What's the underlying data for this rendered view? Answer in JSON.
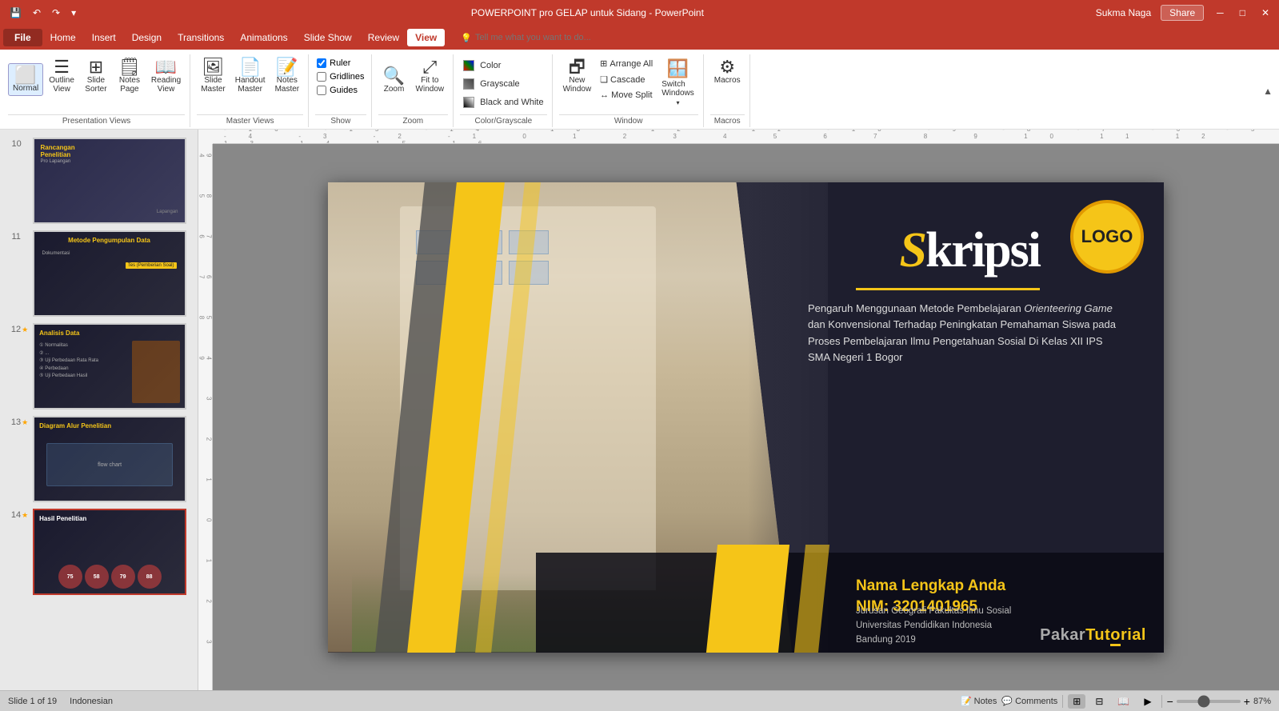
{
  "titlebar": {
    "title": "POWERPOINT pro GELAP untuk Sidang - PowerPoint",
    "quickaccess": [
      "save",
      "undo",
      "redo",
      "more"
    ]
  },
  "menubar": {
    "items": [
      "File",
      "Home",
      "Insert",
      "Design",
      "Transitions",
      "Animations",
      "Slide Show",
      "Review",
      "View"
    ],
    "active": "View",
    "tell_me_placeholder": "Tell me what you want to do...",
    "user": "Sukma Naga",
    "share": "Share"
  },
  "ribbon": {
    "presentation_views": {
      "label": "Presentation Views",
      "buttons": [
        "Normal",
        "Outline View",
        "Slide Sorter",
        "Notes Page",
        "Reading View"
      ]
    },
    "master_views": {
      "label": "Master Views",
      "buttons": [
        "Slide Master",
        "Handout Master",
        "Notes Master"
      ]
    },
    "show": {
      "label": "Show",
      "checkboxes": [
        "Ruler",
        "Gridlines",
        "Guides"
      ]
    },
    "zoom": {
      "label": "Zoom",
      "buttons": [
        "Zoom",
        "Fit to Window"
      ]
    },
    "color_grayscale": {
      "label": "Color/Grayscale",
      "items": [
        "Color",
        "Grayscale",
        "Black and White"
      ]
    },
    "window": {
      "label": "Window",
      "buttons": [
        "New Window",
        "Arrange All",
        "Cascade",
        "Move Split",
        "Switch Windows"
      ]
    },
    "macros": {
      "label": "Macros",
      "buttons": [
        "Macros"
      ]
    }
  },
  "slides": [
    {
      "number": "10",
      "star": false,
      "label": "Rancangan Penelitian"
    },
    {
      "number": "11",
      "star": false,
      "label": "Metode Pengumpulan Data"
    },
    {
      "number": "12",
      "star": true,
      "label": "Analisis Data"
    },
    {
      "number": "13",
      "star": true,
      "label": "Diagram Alur Penelitian"
    },
    {
      "number": "14",
      "star": true,
      "label": "Hasil Penelitian"
    }
  ],
  "slide_content": {
    "title_prefix": "S",
    "title_rest": "kripsi",
    "subtitle": "Pengaruh Menggunaan Metode Pembelajaran Orienteering Game dan Konvensional Terhadap Peningkatan Pemahaman Siswa pada Proses Pembelajaran Ilmu Pengetahuan Sosial Di Kelas XII IPS SMA Negeri 1 Bogor",
    "name": "Nama Lengkap Anda",
    "nim": "NIM: 3201401965",
    "institution_line1": "Jurusan Geografi  Fakultas Ilmu Sosial",
    "institution_line2": "Universitas Pendidikan Indonesia",
    "institution_line3": "Bandung 2019",
    "logo": "LOGO",
    "watermark": "PakarTutorial"
  },
  "statusbar": {
    "slide_info": "Slide 1 of 19",
    "language": "Indonesian",
    "notes_label": "Notes",
    "comments_label": "Comments",
    "zoom_percent": "87%",
    "view_buttons": [
      "normal",
      "slidesorter",
      "reading",
      "presenter"
    ]
  }
}
